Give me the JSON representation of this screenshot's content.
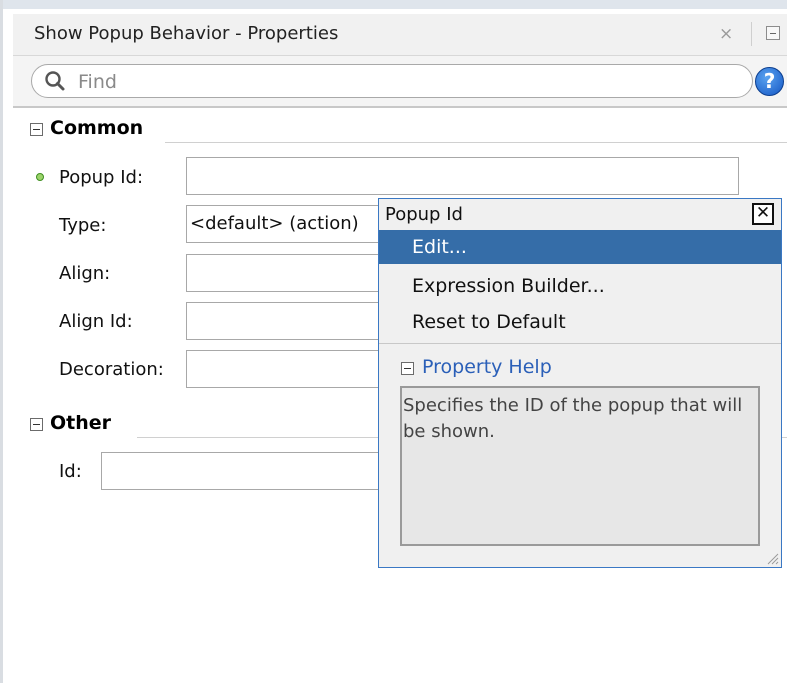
{
  "panel": {
    "title": "Show Popup Behavior - Properties",
    "close_glyph": "×"
  },
  "search": {
    "placeholder": "Find",
    "value": "",
    "icon": "search-icon",
    "help_glyph": "?"
  },
  "sections": {
    "common": {
      "label": "Common",
      "properties": {
        "popup_id": {
          "label": "Popup Id:",
          "value": ""
        },
        "type": {
          "label": "Type:",
          "value": "<default> (action)"
        },
        "align": {
          "label": "Align:",
          "value": ""
        },
        "align_id": {
          "label": "Align Id:",
          "value": ""
        },
        "decoration": {
          "label": "Decoration:",
          "value": ""
        }
      }
    },
    "other": {
      "label": "Other",
      "properties": {
        "id": {
          "label": "Id:",
          "value": ""
        }
      }
    }
  },
  "popup": {
    "title": "Popup Id",
    "close_glyph": "✕",
    "menu": {
      "edit": "Edit...",
      "expression_builder": "Expression Builder...",
      "reset": "Reset to Default"
    },
    "help_header": "Property Help",
    "help_text": "Specifies the ID of the popup that will be shown."
  },
  "colors": {
    "selection": "#356da8",
    "popup_border": "#3a78c4",
    "required_dot": "#9bd36a",
    "help_link": "#2a5fb8"
  }
}
